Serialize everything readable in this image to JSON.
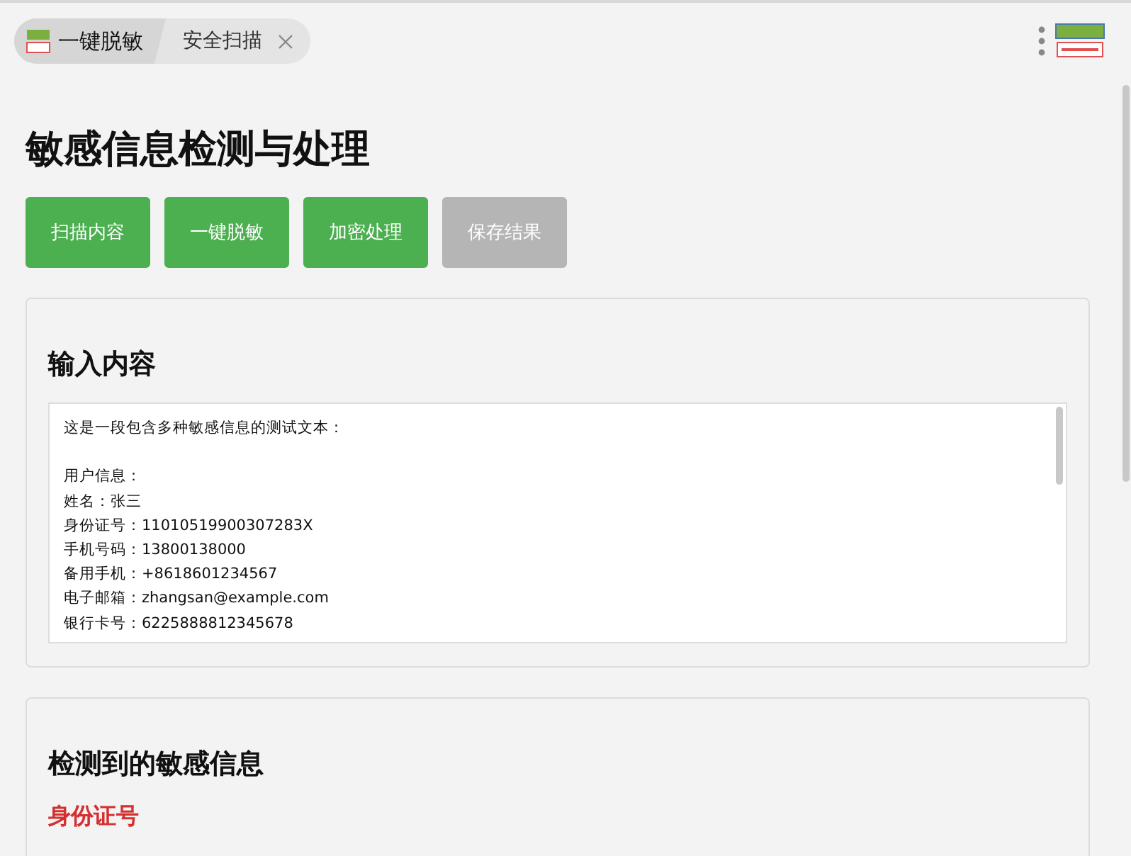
{
  "tabs": [
    {
      "label": "一键脱敏",
      "selected": true,
      "closable": false
    },
    {
      "label": "安全扫描",
      "selected": false,
      "closable": true
    }
  ],
  "page": {
    "title": "敏感信息检测与处理"
  },
  "actions": [
    {
      "label": "扫描内容",
      "disabled": false
    },
    {
      "label": "一键脱敏",
      "disabled": false
    },
    {
      "label": "加密处理",
      "disabled": false
    },
    {
      "label": "保存结果",
      "disabled": true
    }
  ],
  "input_card": {
    "heading": "输入内容",
    "intro": "这是一段包含多种敏感信息的测试文本：",
    "lines": [
      "用户信息：",
      "姓名：张三",
      "身份证号：11010519900307283X",
      "手机号码：13800138000",
      "备用手机：+8618601234567",
      "电子邮箱：zhangsan@example.com",
      "银行卡号：6225888812345678"
    ]
  },
  "results_card": {
    "heading": "检测到的敏感信息",
    "groups": [
      {
        "title": "身份证号"
      }
    ]
  }
}
